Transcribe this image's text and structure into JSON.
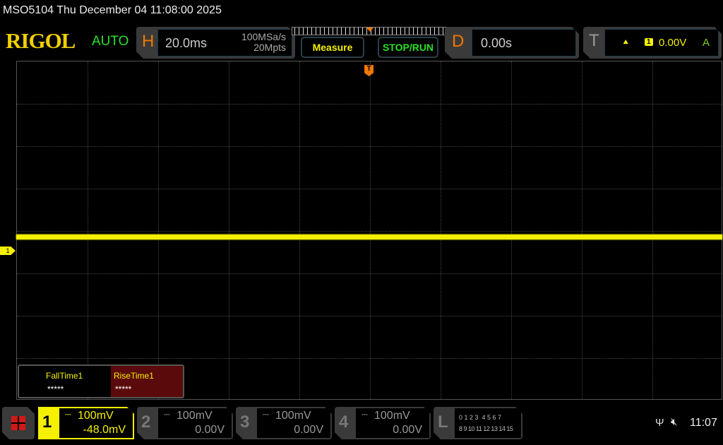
{
  "status_bar": {
    "title": "MSO5104  Thu December 04 11:08:00 2025"
  },
  "brand": {
    "logo": "RIGOL",
    "mode": "AUTO"
  },
  "horizontal": {
    "letter": "H",
    "timebase": "20.0ms",
    "sample_rate": "100MSa/s",
    "memory_depth": "20Mpts"
  },
  "buttons": {
    "measure": "Measure",
    "stop_run": "STOP/RUN"
  },
  "delay": {
    "letter": "D",
    "value": "0.00s"
  },
  "trigger": {
    "letter": "T",
    "source": "1",
    "level": "0.00V",
    "sweep": "A"
  },
  "measurements": [
    {
      "label": "FallTime1",
      "value": "*****"
    },
    {
      "label": "RiseTime1",
      "value": "*****"
    }
  ],
  "channel_marker": "1",
  "trigger_marker": "T",
  "channels": [
    {
      "num": "1",
      "scale": "100mV",
      "offset": "-48.0mV",
      "color": "#f4f000"
    },
    {
      "num": "2",
      "scale": "100mV",
      "offset": "0.00V"
    },
    {
      "num": "3",
      "scale": "100mV",
      "offset": "0.00V"
    },
    {
      "num": "4",
      "scale": "100mV",
      "offset": "0.00V"
    }
  ],
  "logic": {
    "letter": "L",
    "row1": "0 1 2 3  4 5 6 7",
    "row2": "8 9 10 11 12 13 14 15"
  },
  "system": {
    "time": "11:07"
  },
  "colors": {
    "accent_orange": "#f07800",
    "trace": "#f4f000",
    "green": "#2be02b"
  }
}
